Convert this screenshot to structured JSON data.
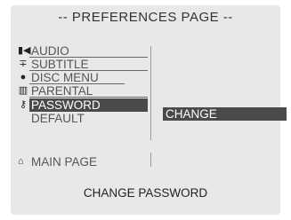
{
  "header": {
    "title": "-- PREFERENCES PAGE --"
  },
  "menu": {
    "items": [
      {
        "label": "AUDIO",
        "icon": "speaker-icon"
      },
      {
        "label": "SUBTITLE",
        "icon": "subtitle-icon"
      },
      {
        "label": "DISC MENU",
        "icon": "disc-icon"
      },
      {
        "label": "PARENTAL",
        "icon": "lock-icon"
      },
      {
        "label": "PASSWORD",
        "icon": "key-icon",
        "selected": true
      },
      {
        "label": "DEFAULT",
        "icon": ""
      }
    ]
  },
  "submenu": {
    "option": "CHANGE"
  },
  "nav": {
    "main_page": "MAIN PAGE",
    "icon": "home-icon"
  },
  "footer": {
    "status": "CHANGE PASSWORD"
  },
  "colors": {
    "panel": "#e8e8e8",
    "highlight": "#4a4a4a",
    "highlight_text": "#ffffff"
  }
}
